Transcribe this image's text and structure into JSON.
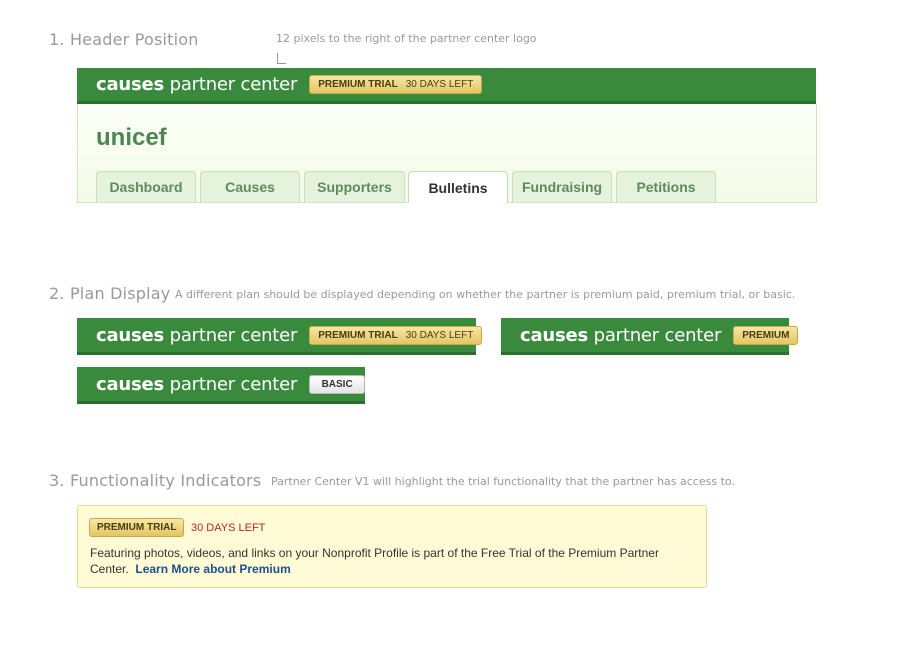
{
  "section1": {
    "title": "1. Header Position",
    "note": "12 pixels to the right of the partner center logo"
  },
  "header": {
    "logo_bold": "causes",
    "logo_light": "partner center",
    "badge_strong": "PREMIUM TRIAL",
    "badge_light": "30 DAYS LEFT"
  },
  "org": {
    "name": "unicef"
  },
  "tabs": [
    {
      "label": "Dashboard"
    },
    {
      "label": "Causes"
    },
    {
      "label": "Supporters"
    },
    {
      "label": "Bulletins"
    },
    {
      "label": "Fundraising"
    },
    {
      "label": "Petitions"
    }
  ],
  "active_tab": "Bulletins",
  "section2": {
    "title": "2. Plan Display",
    "note": "A different plan should be displayed depending on whether the partner is premium paid, premium trial, or basic."
  },
  "plans": {
    "trial_strong": "PREMIUM TRIAL",
    "trial_light": "30 DAYS LEFT",
    "premium": "PREMIUM",
    "basic": "BASIC"
  },
  "section3": {
    "title": "3. Functionality Indicators",
    "note": "Partner Center V1 will highlight the trial functionality that the partner has access to."
  },
  "notice": {
    "badge": "PREMIUM TRIAL",
    "days": "30 DAYS LEFT",
    "text": "Featuring photos, videos, and links on your Nonprofit Profile is part of the Free Trial of the Premium Partner Center.",
    "link": "Learn More about Premium"
  },
  "colors": {
    "green": "#3a8a3e",
    "gold_badge": "#e2c664",
    "notice_bg": "#fffbd6",
    "link": "#1d4f8e"
  }
}
